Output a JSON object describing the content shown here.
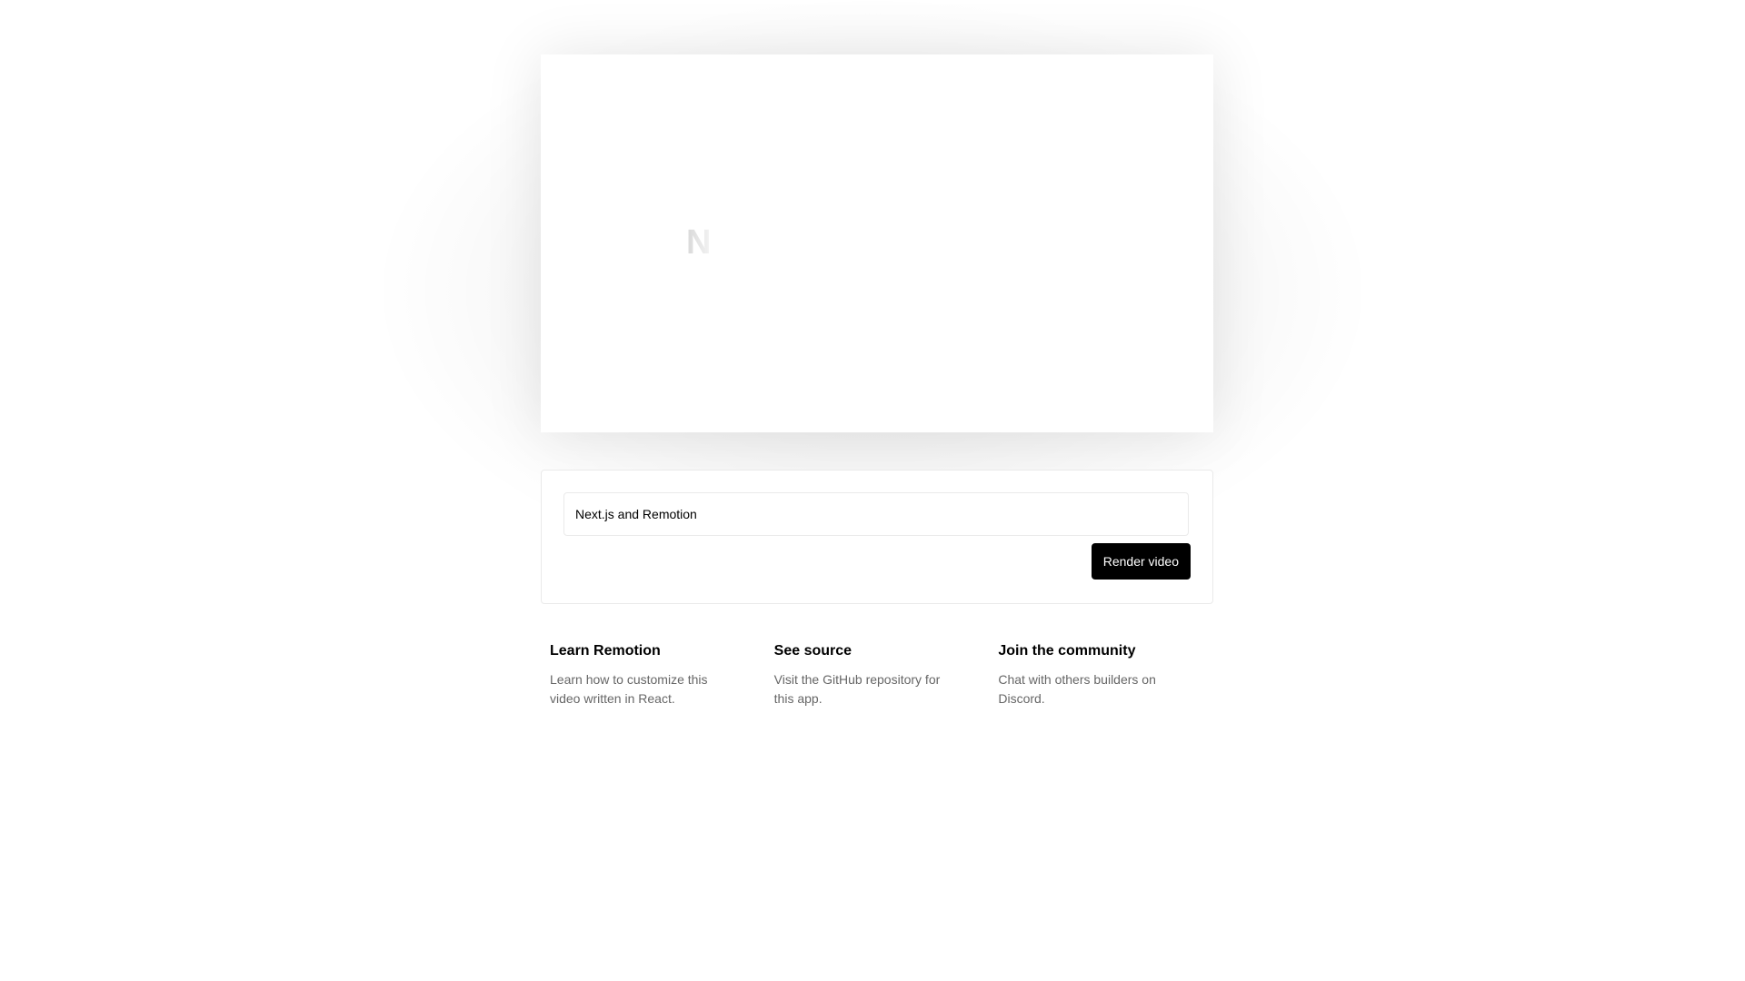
{
  "player": {
    "preview_letter": "N"
  },
  "form": {
    "title_input_value": "Next.js and Remotion",
    "render_button_label": "Render video"
  },
  "links": [
    {
      "title": "Learn Remotion",
      "description": "Learn how to customize this video written in React."
    },
    {
      "title": "See source",
      "description": "Visit the GitHub repository for this app."
    },
    {
      "title": "Join the community",
      "description": "Chat with others builders on Discord."
    }
  ]
}
